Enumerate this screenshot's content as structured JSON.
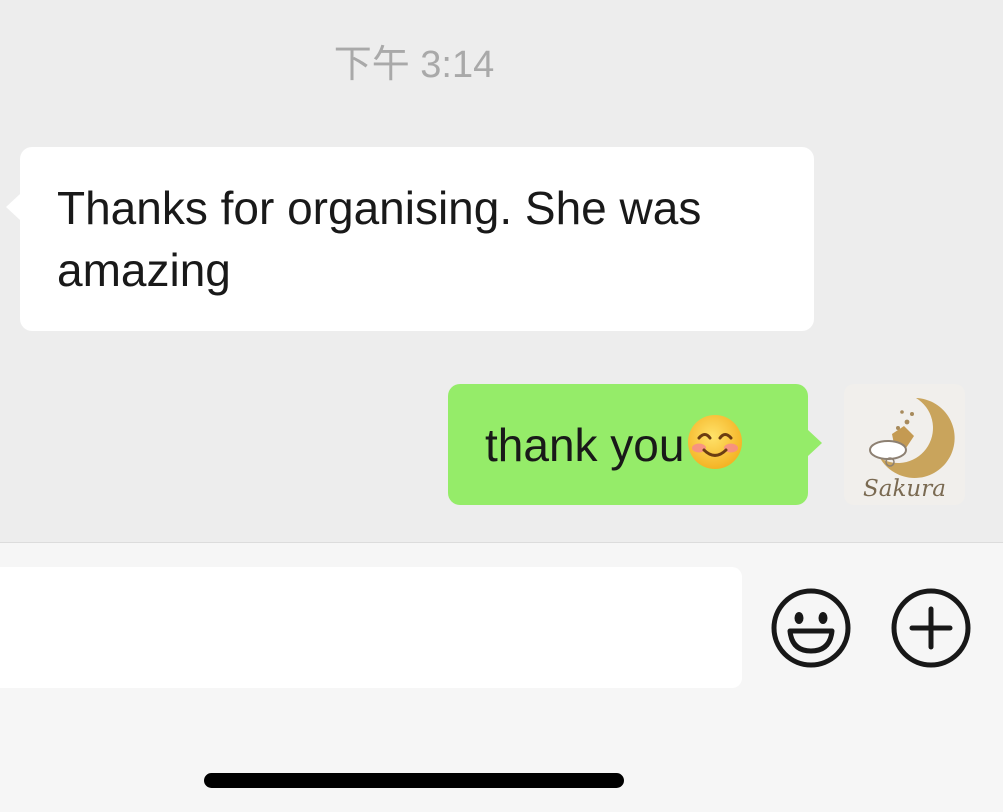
{
  "chat": {
    "timestamp": "下午 3:14",
    "messages": [
      {
        "direction": "incoming",
        "text": "Thanks for organising. She was amazing"
      },
      {
        "direction": "outgoing",
        "text": "thank you",
        "emoji": "smiling-face-with-smiling-eyes"
      }
    ]
  },
  "avatar": {
    "caption": "Sakura"
  },
  "input_bar": {
    "input_value": "",
    "emoji_button_icon": "smiley-face-icon",
    "more_button_icon": "plus-circle-icon"
  },
  "colors": {
    "background": "#ededed",
    "incoming_bubble": "#ffffff",
    "outgoing_bubble": "#95ec69",
    "timestamp_text": "#a9a9a9",
    "input_bar": "#f6f6f6"
  }
}
